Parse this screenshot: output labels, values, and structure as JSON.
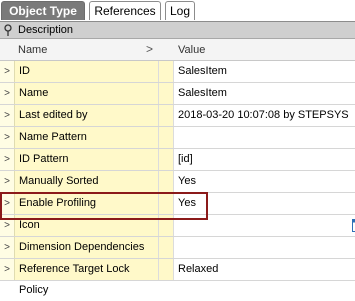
{
  "tabs": [
    {
      "label": "Object Type",
      "active": true
    },
    {
      "label": "References",
      "active": false
    },
    {
      "label": "Log",
      "active": false
    }
  ],
  "description_bar": {
    "label": "Description",
    "icon": "pin-icon"
  },
  "header": {
    "name": "Name",
    "sort_glyph": ">",
    "value": "Value"
  },
  "rows": [
    {
      "expander": ">",
      "name": "ID",
      "value": "SalesItem"
    },
    {
      "expander": ">",
      "name": "Name",
      "value": "SalesItem"
    },
    {
      "expander": ">",
      "name": "Last edited by",
      "value": "2018-03-20 10:07:08 by STEPSYS"
    },
    {
      "expander": ">",
      "name": "Name Pattern",
      "value": ""
    },
    {
      "expander": ">",
      "name": "ID Pattern",
      "value": "[id]"
    },
    {
      "expander": ">",
      "name": "Manually Sorted",
      "value": "Yes"
    },
    {
      "expander": ">",
      "name": "Enable Profiling",
      "value": "Yes"
    },
    {
      "expander": ">",
      "name": "Icon",
      "value": "",
      "icon": "object-type-icon"
    },
    {
      "expander": ">",
      "name": "Dimension Dependencies",
      "value": ""
    },
    {
      "expander": ">",
      "name": "Reference Target Lock Policy",
      "value": "Relaxed"
    }
  ],
  "colors": {
    "name_cell_bg": "#fff9c9",
    "active_tab_bg": "#7a7a7a",
    "highlight_border": "#8b1a1a"
  }
}
